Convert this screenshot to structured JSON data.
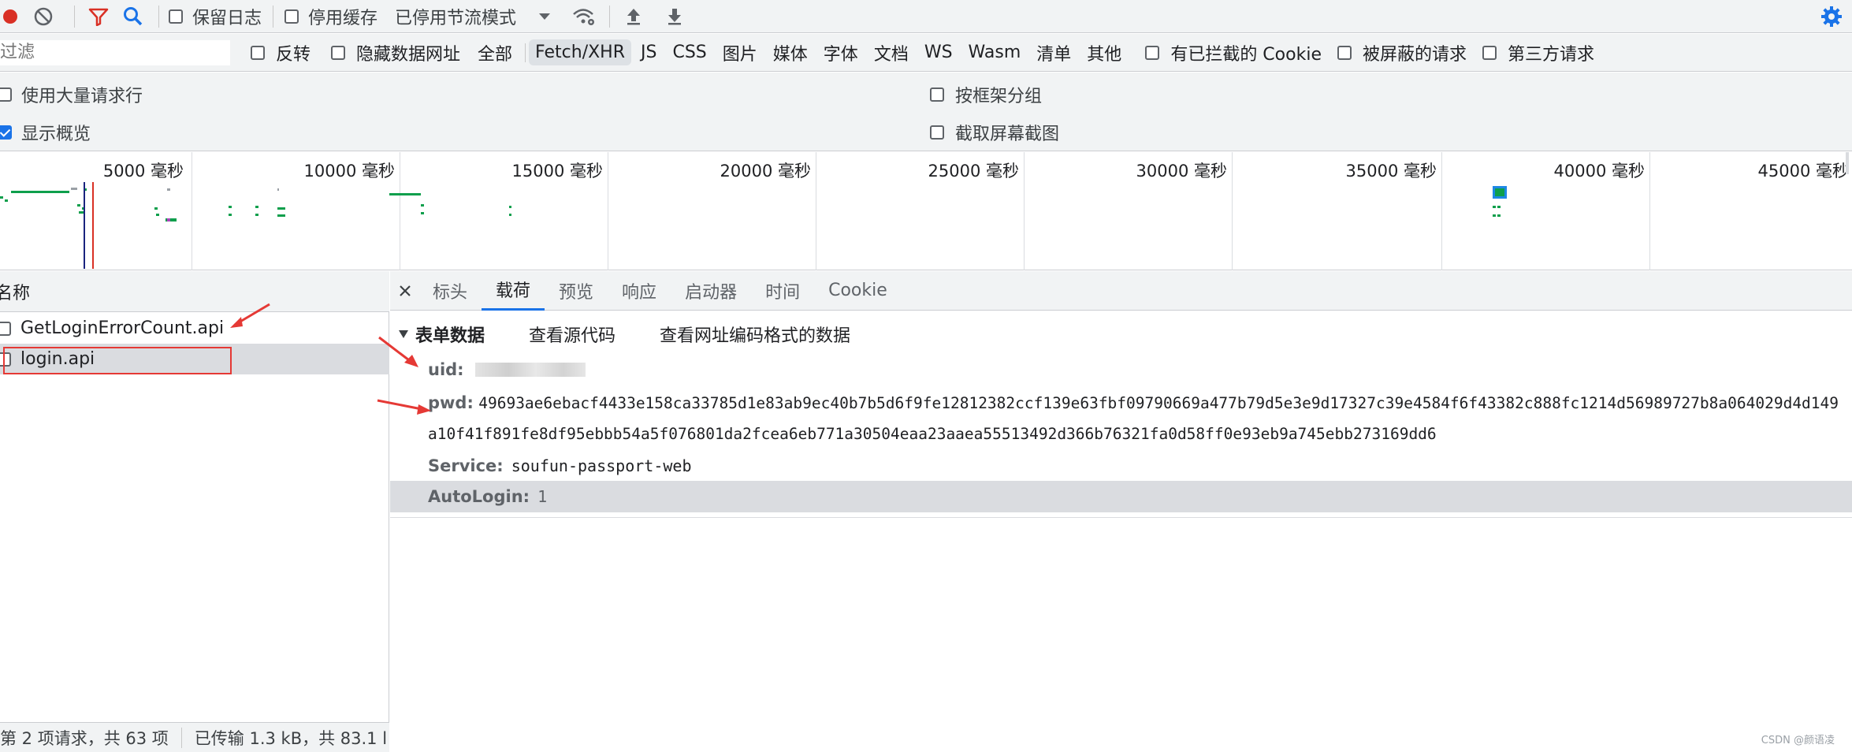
{
  "toolbar": {
    "preserve_log": "保留日志",
    "disable_cache": "停用缓存",
    "throttle": "已停用节流模式"
  },
  "filter": {
    "placeholder": "过滤",
    "invert": "反转",
    "hide_data_urls": "隐藏数据网址",
    "types": [
      "全部",
      "Fetch/XHR",
      "JS",
      "CSS",
      "图片",
      "媒体",
      "字体",
      "文档",
      "WS",
      "Wasm",
      "清单",
      "其他"
    ],
    "blocked_cookies": "有已拦截的 Cookie",
    "blocked_requests": "被屏蔽的请求",
    "third_party": "第三方请求"
  },
  "options": {
    "large_rows": "使用大量请求行",
    "group_by_frame": "按框架分组",
    "show_overview": "显示概览",
    "capture_screenshots": "截取屏幕截图"
  },
  "overview": {
    "labels": [
      "5000 毫秒",
      "10000 毫秒",
      "15000 毫秒",
      "20000 毫秒",
      "25000 毫秒",
      "30000 毫秒",
      "35000 毫秒",
      "40000 毫秒",
      "45000 毫秒"
    ]
  },
  "requests": {
    "header": "名称",
    "items": [
      {
        "name": "GetLoginErrorCount.api"
      },
      {
        "name": "login.api"
      }
    ],
    "status_count": "第 2 项请求，共 63 项",
    "status_transfer": "已传输 1.3 kB，共 83.1 l"
  },
  "details": {
    "tabs": [
      "标头",
      "载荷",
      "预览",
      "响应",
      "启动器",
      "时间",
      "Cookie"
    ],
    "section_title": "表单数据",
    "view_source": "查看源代码",
    "view_url_encoded": "查看网址编码格式的数据",
    "fields": [
      {
        "key": "uid:",
        "value": ""
      },
      {
        "key": "pwd:",
        "value": "49693ae6ebacf4433e158ca33785d1e83ab9ec40b7b5d6f9fe12812382ccf139e63fbf09790669a477b79d5e3e9d17327c39e4584f6f43382c888fc1214d56989727b8a064029d4d149a10f41f891fe8df95ebbb54a5f076801da2fcea6eb771a30504eaa23aaea55513492d366b76321fa0d58ff0e93eb9a745ebb273169dd6"
      },
      {
        "key": "Service:",
        "value": "soufun-passport-web"
      },
      {
        "key": "AutoLogin:",
        "value": "1"
      }
    ]
  },
  "watermark": "CSDN @颜语凌"
}
